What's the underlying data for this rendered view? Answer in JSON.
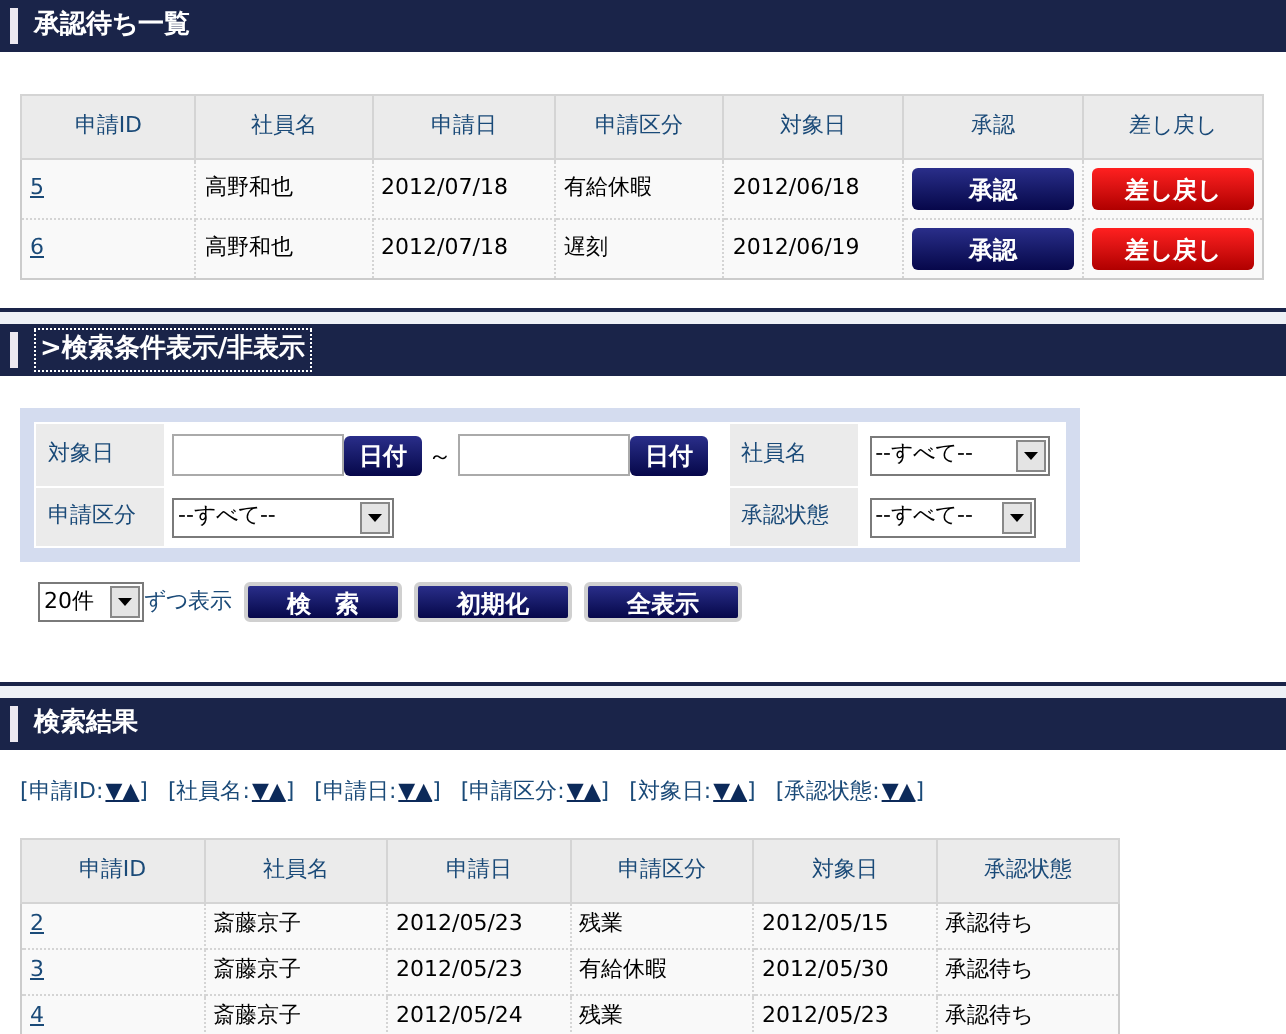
{
  "pending": {
    "title": "承認待ち一覧",
    "columns": [
      "申請ID",
      "社員名",
      "申請日",
      "申請区分",
      "対象日",
      "承認",
      "差し戻し"
    ],
    "rows": [
      {
        "id": "5",
        "name": "高野和也",
        "applied": "2012/07/18",
        "category": "有給休暇",
        "target": "2012/06/18",
        "approve": "承認",
        "reject": "差し戻し"
      },
      {
        "id": "6",
        "name": "高野和也",
        "applied": "2012/07/18",
        "category": "遅刻",
        "target": "2012/06/19",
        "approve": "承認",
        "reject": "差し戻し"
      }
    ]
  },
  "search": {
    "toggle": ">検索条件表示/非表示",
    "target_date": {
      "label": "対象日",
      "button": "日付",
      "separator": "～",
      "button_2": "日付"
    },
    "employee": {
      "label": "社員名",
      "value": "--すべて--"
    },
    "category": {
      "label": "申請区分",
      "value": "--すべて--"
    },
    "status": {
      "label": "承認状態",
      "value": "--すべて--"
    },
    "per_page": {
      "value": "20件",
      "suffix": "ずつ表示"
    },
    "buttons": [
      "検　索",
      "初期化",
      "全表示"
    ]
  },
  "results": {
    "title": "検索結果",
    "sort_links": [
      {
        "open": "[申請ID:",
        "arrows": "▼▲",
        "close": "]"
      },
      {
        "open": "[社員名:",
        "arrows": "▼▲",
        "close": "]"
      },
      {
        "open": "[申請日:",
        "arrows": "▼▲",
        "close": "]"
      },
      {
        "open": "[申請区分:",
        "arrows": "▼▲",
        "close": "]"
      },
      {
        "open": "[対象日:",
        "arrows": "▼▲",
        "close": "]"
      },
      {
        "open": "[承認状態:",
        "arrows": "▼▲",
        "close": "]"
      }
    ],
    "columns": [
      "申請ID",
      "社員名",
      "申請日",
      "申請区分",
      "対象日",
      "承認状態"
    ],
    "rows": [
      {
        "id": "2",
        "name": "斎藤京子",
        "applied": "2012/05/23",
        "category": "残業",
        "target": "2012/05/15",
        "status": "承認待ち"
      },
      {
        "id": "3",
        "name": "斎藤京子",
        "applied": "2012/05/23",
        "category": "有給休暇",
        "target": "2012/05/30",
        "status": "承認待ち"
      },
      {
        "id": "4",
        "name": "斎藤京子",
        "applied": "2012/05/24",
        "category": "残業",
        "target": "2012/05/23",
        "status": "承認待ち"
      }
    ]
  }
}
